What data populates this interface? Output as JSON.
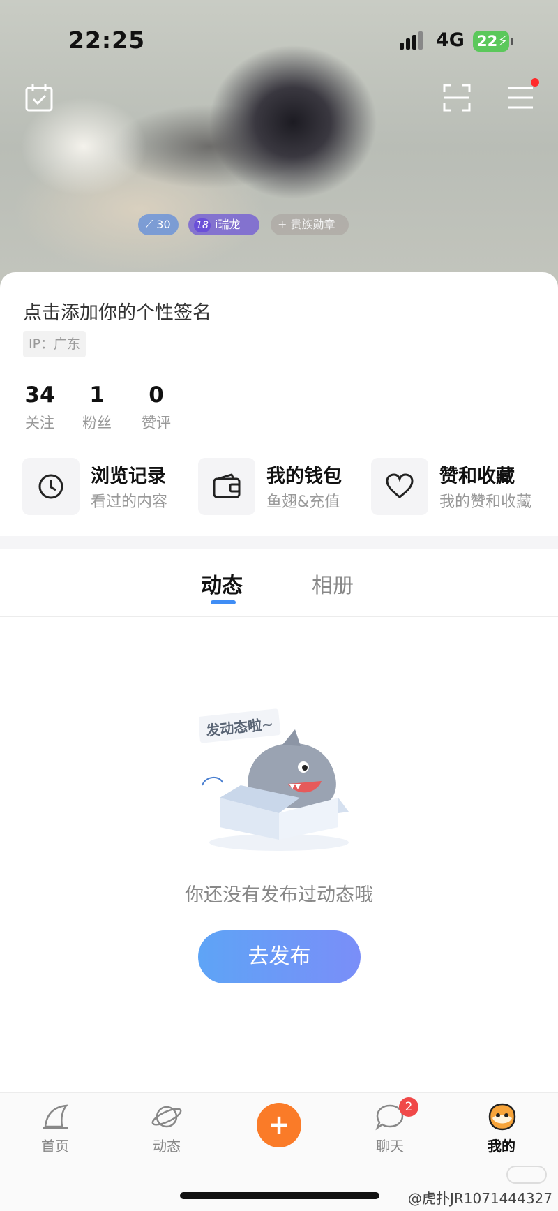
{
  "status_bar": {
    "time": "22:25",
    "network": "4G",
    "battery": "22"
  },
  "header": {
    "badges": {
      "level": "30",
      "fan_number": "18",
      "fan_name": "i瑞龙",
      "noble": "+ 贵族勋章"
    }
  },
  "profile": {
    "signature": "点击添加你的个性签名",
    "ip_label": "IP：广东",
    "stats": [
      {
        "value": "34",
        "label": "关注"
      },
      {
        "value": "1",
        "label": "粉丝"
      },
      {
        "value": "0",
        "label": "赞评"
      }
    ],
    "features": [
      {
        "title": "浏览记录",
        "subtitle": "看过的内容",
        "icon": "clock-icon"
      },
      {
        "title": "我的钱包",
        "subtitle": "鱼翅&充值",
        "icon": "wallet-icon"
      },
      {
        "title": "赞和收藏",
        "subtitle": "我的赞和收藏",
        "icon": "heart-icon"
      }
    ]
  },
  "tabs": {
    "dynamic": "动态",
    "album": "相册"
  },
  "empty_state": {
    "illustration_text": "发动态啦~",
    "message": "你还没有发布过动态哦",
    "button": "去发布"
  },
  "bottom_nav": {
    "home": "首页",
    "dynamic": "动态",
    "plus": "+",
    "chat": "聊天",
    "chat_badge": "2",
    "mine": "我的"
  },
  "watermark": "@虎扑JR1071444327",
  "colors": {
    "accent_blue": "#3f8df5",
    "plus_orange": "#fa7b28",
    "badge_red": "#f04848"
  }
}
